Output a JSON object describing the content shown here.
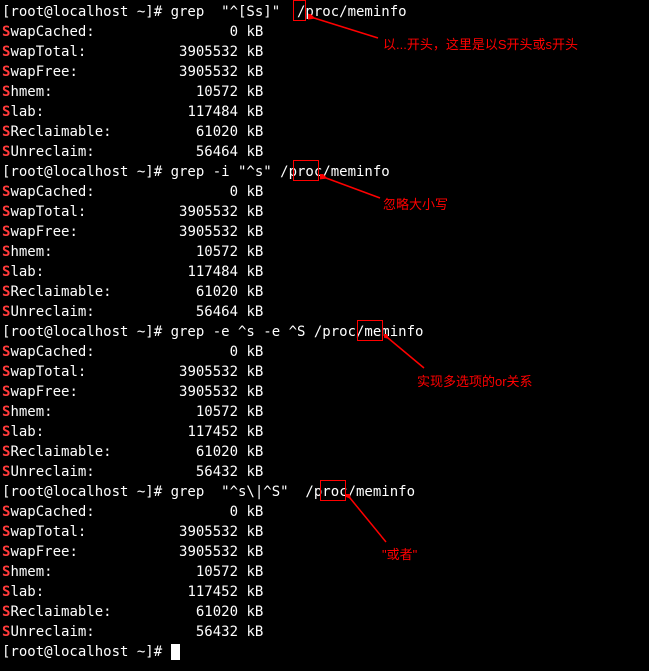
{
  "prompt": "[root@localhost ~]# ",
  "cmds": {
    "cmd1": {
      "cmd": "grep",
      "arg1": "\"",
      "argHL": "^",
      "arg2": "[Ss]\"",
      "path": "/proc/meminfo"
    },
    "cmd2": {
      "cmd": "grep",
      "flagHL": "-i",
      "arg1": "\"^s\"",
      "path": "/proc/meminfo"
    },
    "cmd3": {
      "cmd": "grep",
      "flag1": "-e",
      "arg1": "^s",
      "flagHL": "-e",
      "arg2": "^S",
      "path": "/proc/meminfo"
    },
    "cmd4": {
      "cmd": "grep",
      "arg1": "\"^s",
      "argHL": "\\|",
      "arg2": "^S\"",
      "path": "/proc/meminfo"
    }
  },
  "blocks": {
    "b1": [
      {
        "hl": "S",
        "rest": "wapCached:",
        "val": "0",
        "unit": "kB"
      },
      {
        "hl": "S",
        "rest": "wapTotal:",
        "val": "3905532",
        "unit": "kB"
      },
      {
        "hl": "S",
        "rest": "wapFree:",
        "val": "3905532",
        "unit": "kB"
      },
      {
        "hl": "S",
        "rest": "hmem:",
        "val": "10572",
        "unit": "kB"
      },
      {
        "hl": "S",
        "rest": "lab:",
        "val": "117484",
        "unit": "kB"
      },
      {
        "hl": "S",
        "rest": "Reclaimable:",
        "val": "61020",
        "unit": "kB"
      },
      {
        "hl": "S",
        "rest": "Unreclaim:",
        "val": "56464",
        "unit": "kB"
      }
    ],
    "b2": [
      {
        "hl": "S",
        "rest": "wapCached:",
        "val": "0",
        "unit": "kB"
      },
      {
        "hl": "S",
        "rest": "wapTotal:",
        "val": "3905532",
        "unit": "kB"
      },
      {
        "hl": "S",
        "rest": "wapFree:",
        "val": "3905532",
        "unit": "kB"
      },
      {
        "hl": "S",
        "rest": "hmem:",
        "val": "10572",
        "unit": "kB"
      },
      {
        "hl": "S",
        "rest": "lab:",
        "val": "117484",
        "unit": "kB"
      },
      {
        "hl": "S",
        "rest": "Reclaimable:",
        "val": "61020",
        "unit": "kB"
      },
      {
        "hl": "S",
        "rest": "Unreclaim:",
        "val": "56464",
        "unit": "kB"
      }
    ],
    "b3": [
      {
        "hl": "S",
        "rest": "wapCached:",
        "val": "0",
        "unit": "kB"
      },
      {
        "hl": "S",
        "rest": "wapTotal:",
        "val": "3905532",
        "unit": "kB"
      },
      {
        "hl": "S",
        "rest": "wapFree:",
        "val": "3905532",
        "unit": "kB"
      },
      {
        "hl": "S",
        "rest": "hmem:",
        "val": "10572",
        "unit": "kB"
      },
      {
        "hl": "S",
        "rest": "lab:",
        "val": "117452",
        "unit": "kB"
      },
      {
        "hl": "S",
        "rest": "Reclaimable:",
        "val": "61020",
        "unit": "kB"
      },
      {
        "hl": "S",
        "rest": "Unreclaim:",
        "val": "56432",
        "unit": "kB"
      }
    ],
    "b4": [
      {
        "hl": "S",
        "rest": "wapCached:",
        "val": "0",
        "unit": "kB"
      },
      {
        "hl": "S",
        "rest": "wapTotal:",
        "val": "3905532",
        "unit": "kB"
      },
      {
        "hl": "S",
        "rest": "wapFree:",
        "val": "3905532",
        "unit": "kB"
      },
      {
        "hl": "S",
        "rest": "hmem:",
        "val": "10572",
        "unit": "kB"
      },
      {
        "hl": "S",
        "rest": "lab:",
        "val": "117452",
        "unit": "kB"
      },
      {
        "hl": "S",
        "rest": "Reclaimable:",
        "val": "61020",
        "unit": "kB"
      },
      {
        "hl": "S",
        "rest": "Unreclaim:",
        "val": "56432",
        "unit": "kB"
      }
    ]
  },
  "annotations": {
    "a1": "以...开头，这里是以S开头或s开头",
    "a2": "忽略大小写",
    "a3": "实现多选项的or关系",
    "a4": "\"或者\""
  }
}
